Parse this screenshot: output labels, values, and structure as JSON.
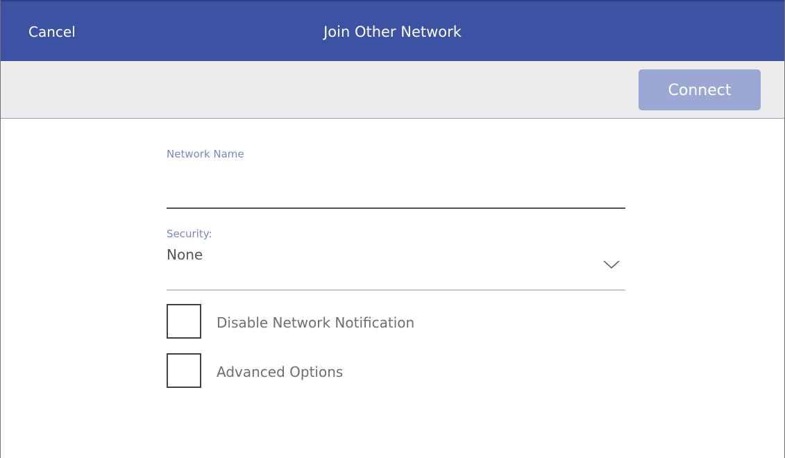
{
  "header": {
    "cancel_label": "Cancel",
    "title": "Join Other Network"
  },
  "toolbar": {
    "connect_label": "Connect"
  },
  "form": {
    "network_name": {
      "label": "Network Name",
      "value": ""
    },
    "security": {
      "label": "Security:",
      "selected": "None"
    },
    "checkboxes": [
      {
        "label": "Disable Network Notification",
        "checked": false
      },
      {
        "label": "Advanced Options",
        "checked": false
      }
    ]
  },
  "colors": {
    "header_bg": "#3c52a3",
    "toolbar_bg": "#ececec",
    "connect_disabled_bg": "#9aa8d3",
    "label_accent": "#7a88be"
  },
  "icons": {
    "security_dropdown": "chevron-down-icon"
  }
}
